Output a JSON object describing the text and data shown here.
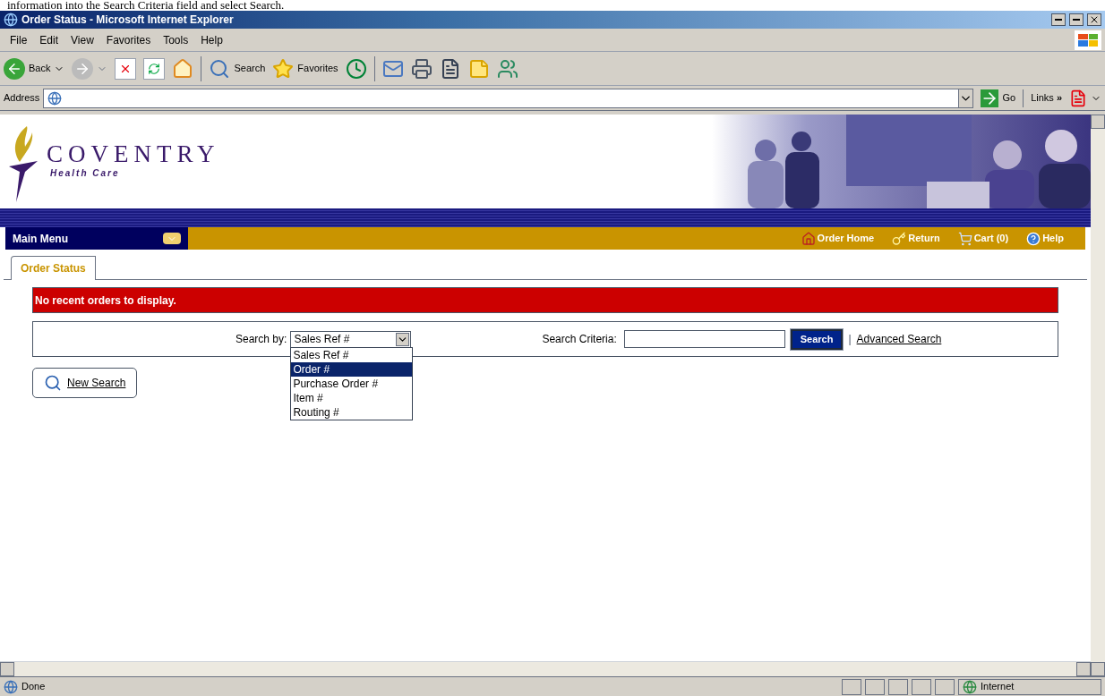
{
  "caption": "information into the Search Criteria field and select Search.",
  "window": {
    "title": "Order Status - Microsoft Internet Explorer"
  },
  "menu_bar": [
    "File",
    "Edit",
    "View",
    "Favorites",
    "Tools",
    "Help"
  ],
  "toolbar": {
    "back": "Back",
    "search": "Search",
    "favorites": "Favorites"
  },
  "address_bar": {
    "label": "Address",
    "go": "Go",
    "links": "Links",
    "chevron": "»"
  },
  "logo": {
    "name": "COVENTRY",
    "tagline": "Health Care"
  },
  "nav": {
    "main_menu": "Main Menu",
    "links": [
      "Order Home",
      "Return",
      "Cart (0)",
      "Help"
    ]
  },
  "tabs": [
    {
      "label": "Order Status",
      "selected": true
    }
  ],
  "alert": "No recent orders to display.",
  "search": {
    "label": "Search by:",
    "select_value": "Sales Ref #",
    "expanded": true,
    "options": [
      {
        "label": "Sales Ref #",
        "selected": false
      },
      {
        "label": "Order #",
        "selected": true
      },
      {
        "label": "Purchase Order #",
        "selected": false
      },
      {
        "label": "Item #",
        "selected": false
      },
      {
        "label": "Routing #",
        "selected": false
      }
    ],
    "criteria_label": "Search Criteria:",
    "button": "Search",
    "separator": "|",
    "advanced": "Advanced Search"
  },
  "new_search": "New Search",
  "status_bar": {
    "text": "Done",
    "zone": "Internet"
  }
}
